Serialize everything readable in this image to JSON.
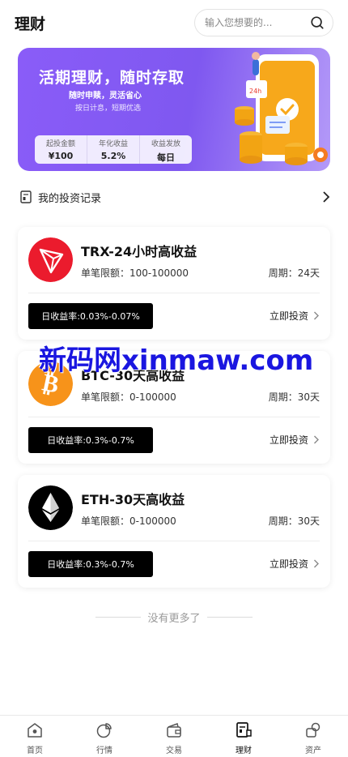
{
  "header": {
    "title": "理财",
    "search_placeholder": "输入您想要的..."
  },
  "banner": {
    "title": "活期理财，随时存取",
    "subtitle": "随时申赎，灵活省心",
    "note": "按日计息，短期优选",
    "stats": [
      {
        "label": "起投金额",
        "value": "¥100"
      },
      {
        "label": "年化收益",
        "value": "5.2%"
      },
      {
        "label": "收益发放",
        "value": "每日"
      }
    ]
  },
  "records": {
    "label": "我的投资记录"
  },
  "products": [
    {
      "name": "TRX-24小时高收益",
      "limit": "单笔限额：100-100000",
      "period": "周期：24天",
      "rate": "日收益率:0.03%-0.07%",
      "action": "立即投资",
      "coin": "trx-coin-icon",
      "color": "#eb1b2d"
    },
    {
      "name": "BTC-30天高收益",
      "limit": "单笔限额：0-100000",
      "period": "周期：30天",
      "rate": "日收益率:0.3%-0.7%",
      "action": "立即投资",
      "coin": "btc-coin-icon",
      "color": "#f7931a"
    },
    {
      "name": "ETH-30天高收益",
      "limit": "单笔限额：0-100000",
      "period": "周期：30天",
      "rate": "日收益率:0.3%-0.7%",
      "action": "立即投资",
      "coin": "eth-coin-icon",
      "color": "#000000"
    }
  ],
  "watermark": "新码网xinmaw.com",
  "footer_text": "没有更多了",
  "tabs": [
    {
      "label": "首页",
      "icon": "home-icon"
    },
    {
      "label": "行情",
      "icon": "market-icon"
    },
    {
      "label": "交易",
      "icon": "wallet-icon"
    },
    {
      "label": "理财",
      "icon": "finance-icon",
      "active": true
    },
    {
      "label": "资产",
      "icon": "assets-icon"
    }
  ]
}
